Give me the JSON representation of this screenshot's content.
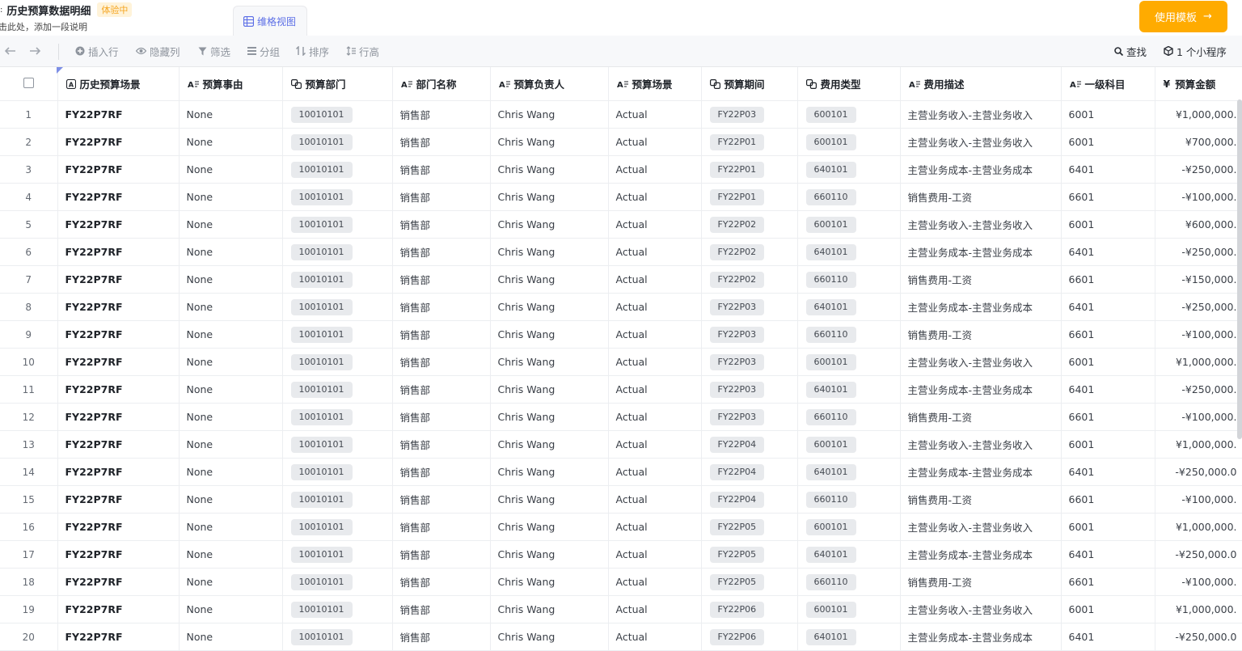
{
  "header": {
    "title": "历史预算数据明细",
    "badge": "体验中",
    "description": "击此处，添加一段说明",
    "view_tab": "维格视图",
    "use_template": "使用模板"
  },
  "toolbar": {
    "insert_row": "插入行",
    "hide_columns": "隐藏列",
    "filter": "筛选",
    "group": "分组",
    "sort": "排序",
    "row_height": "行高",
    "search": "查找",
    "mini_program": "1 个小程序"
  },
  "columns": [
    {
      "label": "历史预算场景",
      "icon": "primary-field-icon"
    },
    {
      "label": "预算事由",
      "icon": "text-field-icon"
    },
    {
      "label": "预算部门",
      "icon": "link-field-icon"
    },
    {
      "label": "部门名称",
      "icon": "text-field-icon"
    },
    {
      "label": "预算负责人",
      "icon": "text-field-icon"
    },
    {
      "label": "预算场景",
      "icon": "text-field-icon"
    },
    {
      "label": "预算期间",
      "icon": "link-field-icon"
    },
    {
      "label": "费用类型",
      "icon": "link-field-icon"
    },
    {
      "label": "费用描述",
      "icon": "text-field-icon"
    },
    {
      "label": "一级科目",
      "icon": "text-field-icon"
    },
    {
      "label": "预算金额",
      "icon": "currency-field-icon"
    }
  ],
  "rows": [
    {
      "idx": "1",
      "scene": "FY22P7RF",
      "reason": "None",
      "dept": "10010101",
      "dept_name": "销售部",
      "owner": "Chris Wang",
      "budget_scene": "Actual",
      "period": "FY22P03",
      "cost_type": "600101",
      "cost_desc": "主营业务收入-主营业务收入",
      "subject": "6001",
      "amount": "¥1,000,000."
    },
    {
      "idx": "2",
      "scene": "FY22P7RF",
      "reason": "None",
      "dept": "10010101",
      "dept_name": "销售部",
      "owner": "Chris Wang",
      "budget_scene": "Actual",
      "period": "FY22P01",
      "cost_type": "600101",
      "cost_desc": "主营业务收入-主营业务收入",
      "subject": "6001",
      "amount": "¥700,000."
    },
    {
      "idx": "3",
      "scene": "FY22P7RF",
      "reason": "None",
      "dept": "10010101",
      "dept_name": "销售部",
      "owner": "Chris Wang",
      "budget_scene": "Actual",
      "period": "FY22P01",
      "cost_type": "640101",
      "cost_desc": "主营业务成本-主营业务成本",
      "subject": "6401",
      "amount": "-¥250,000."
    },
    {
      "idx": "4",
      "scene": "FY22P7RF",
      "reason": "None",
      "dept": "10010101",
      "dept_name": "销售部",
      "owner": "Chris Wang",
      "budget_scene": "Actual",
      "period": "FY22P01",
      "cost_type": "660110",
      "cost_desc": "销售费用-工资",
      "subject": "6601",
      "amount": "-¥100,000."
    },
    {
      "idx": "5",
      "scene": "FY22P7RF",
      "reason": "None",
      "dept": "10010101",
      "dept_name": "销售部",
      "owner": "Chris Wang",
      "budget_scene": "Actual",
      "period": "FY22P02",
      "cost_type": "600101",
      "cost_desc": "主营业务收入-主营业务收入",
      "subject": "6001",
      "amount": "¥600,000."
    },
    {
      "idx": "6",
      "scene": "FY22P7RF",
      "reason": "None",
      "dept": "10010101",
      "dept_name": "销售部",
      "owner": "Chris Wang",
      "budget_scene": "Actual",
      "period": "FY22P02",
      "cost_type": "640101",
      "cost_desc": "主营业务成本-主营业务成本",
      "subject": "6401",
      "amount": "-¥250,000."
    },
    {
      "idx": "7",
      "scene": "FY22P7RF",
      "reason": "None",
      "dept": "10010101",
      "dept_name": "销售部",
      "owner": "Chris Wang",
      "budget_scene": "Actual",
      "period": "FY22P02",
      "cost_type": "660110",
      "cost_desc": "销售费用-工资",
      "subject": "6601",
      "amount": "-¥150,000."
    },
    {
      "idx": "8",
      "scene": "FY22P7RF",
      "reason": "None",
      "dept": "10010101",
      "dept_name": "销售部",
      "owner": "Chris Wang",
      "budget_scene": "Actual",
      "period": "FY22P03",
      "cost_type": "640101",
      "cost_desc": "主营业务成本-主营业务成本",
      "subject": "6401",
      "amount": "-¥250,000."
    },
    {
      "idx": "9",
      "scene": "FY22P7RF",
      "reason": "None",
      "dept": "10010101",
      "dept_name": "销售部",
      "owner": "Chris Wang",
      "budget_scene": "Actual",
      "period": "FY22P03",
      "cost_type": "660110",
      "cost_desc": "销售费用-工资",
      "subject": "6601",
      "amount": "-¥100,000."
    },
    {
      "idx": "10",
      "scene": "FY22P7RF",
      "reason": "None",
      "dept": "10010101",
      "dept_name": "销售部",
      "owner": "Chris Wang",
      "budget_scene": "Actual",
      "period": "FY22P03",
      "cost_type": "600101",
      "cost_desc": "主营业务收入-主营业务收入",
      "subject": "6001",
      "amount": "¥1,000,000."
    },
    {
      "idx": "11",
      "scene": "FY22P7RF",
      "reason": "None",
      "dept": "10010101",
      "dept_name": "销售部",
      "owner": "Chris Wang",
      "budget_scene": "Actual",
      "period": "FY22P03",
      "cost_type": "640101",
      "cost_desc": "主营业务成本-主营业务成本",
      "subject": "6401",
      "amount": "-¥250,000."
    },
    {
      "idx": "12",
      "scene": "FY22P7RF",
      "reason": "None",
      "dept": "10010101",
      "dept_name": "销售部",
      "owner": "Chris Wang",
      "budget_scene": "Actual",
      "period": "FY22P03",
      "cost_type": "660110",
      "cost_desc": "销售费用-工资",
      "subject": "6601",
      "amount": "-¥100,000."
    },
    {
      "idx": "13",
      "scene": "FY22P7RF",
      "reason": "None",
      "dept": "10010101",
      "dept_name": "销售部",
      "owner": "Chris Wang",
      "budget_scene": "Actual",
      "period": "FY22P04",
      "cost_type": "600101",
      "cost_desc": "主营业务收入-主营业务收入",
      "subject": "6001",
      "amount": "¥1,000,000."
    },
    {
      "idx": "14",
      "scene": "FY22P7RF",
      "reason": "None",
      "dept": "10010101",
      "dept_name": "销售部",
      "owner": "Chris Wang",
      "budget_scene": "Actual",
      "period": "FY22P04",
      "cost_type": "640101",
      "cost_desc": "主营业务成本-主营业务成本",
      "subject": "6401",
      "amount": "-¥250,000.0"
    },
    {
      "idx": "15",
      "scene": "FY22P7RF",
      "reason": "None",
      "dept": "10010101",
      "dept_name": "销售部",
      "owner": "Chris Wang",
      "budget_scene": "Actual",
      "period": "FY22P04",
      "cost_type": "660110",
      "cost_desc": "销售费用-工资",
      "subject": "6601",
      "amount": "-¥100,000."
    },
    {
      "idx": "16",
      "scene": "FY22P7RF",
      "reason": "None",
      "dept": "10010101",
      "dept_name": "销售部",
      "owner": "Chris Wang",
      "budget_scene": "Actual",
      "period": "FY22P05",
      "cost_type": "600101",
      "cost_desc": "主营业务收入-主营业务收入",
      "subject": "6001",
      "amount": "¥1,000,000."
    },
    {
      "idx": "17",
      "scene": "FY22P7RF",
      "reason": "None",
      "dept": "10010101",
      "dept_name": "销售部",
      "owner": "Chris Wang",
      "budget_scene": "Actual",
      "period": "FY22P05",
      "cost_type": "640101",
      "cost_desc": "主营业务成本-主营业务成本",
      "subject": "6401",
      "amount": "-¥250,000.0"
    },
    {
      "idx": "18",
      "scene": "FY22P7RF",
      "reason": "None",
      "dept": "10010101",
      "dept_name": "销售部",
      "owner": "Chris Wang",
      "budget_scene": "Actual",
      "period": "FY22P05",
      "cost_type": "660110",
      "cost_desc": "销售费用-工资",
      "subject": "6601",
      "amount": "-¥100,000."
    },
    {
      "idx": "19",
      "scene": "FY22P7RF",
      "reason": "None",
      "dept": "10010101",
      "dept_name": "销售部",
      "owner": "Chris Wang",
      "budget_scene": "Actual",
      "period": "FY22P06",
      "cost_type": "600101",
      "cost_desc": "主营业务收入-主营业务收入",
      "subject": "6001",
      "amount": "¥1,000,000."
    },
    {
      "idx": "20",
      "scene": "FY22P7RF",
      "reason": "None",
      "dept": "10010101",
      "dept_name": "销售部",
      "owner": "Chris Wang",
      "budget_scene": "Actual",
      "period": "FY22P06",
      "cost_type": "640101",
      "cost_desc": "主营业务成本-主营业务成本",
      "subject": "6401",
      "amount": "-¥250,000.0"
    }
  ],
  "colors": {
    "accent": "#ffab00",
    "view_tab": "#5b6ee6",
    "badge_bg": "#fff3d9",
    "badge_text": "#f5a623"
  }
}
